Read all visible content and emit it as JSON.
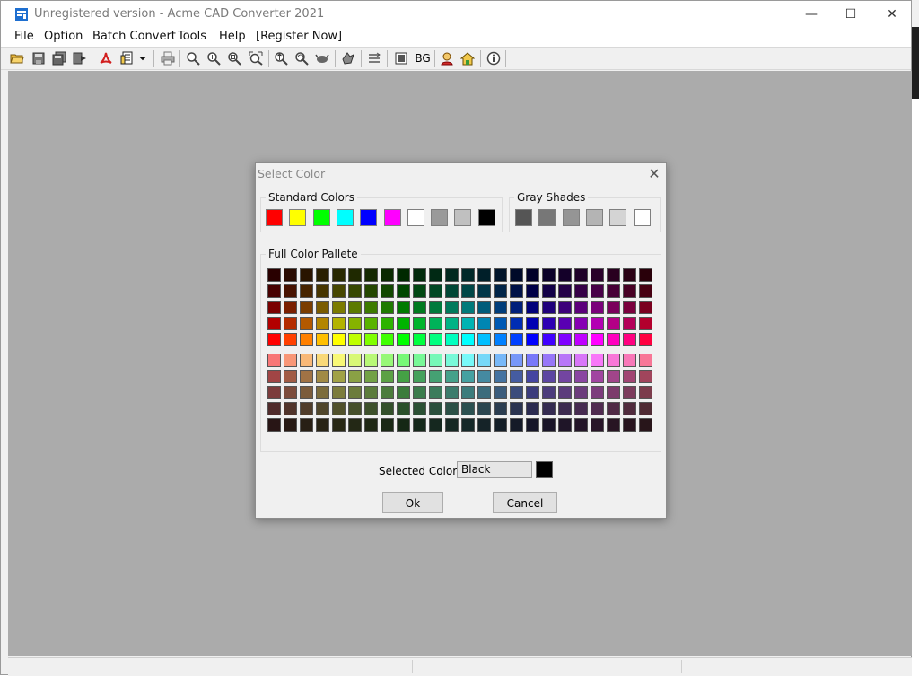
{
  "window": {
    "title": "Unregistered version - Acme CAD Converter 2021",
    "controls": {
      "minimize": "—",
      "maximize": "☐",
      "close": "✕"
    }
  },
  "menu": [
    "File",
    "Option",
    "Batch Convert",
    "Tools",
    "Help",
    "[Register Now]"
  ],
  "toolbar": {
    "bg_label": "BG",
    "icons": [
      "open-folder-icon",
      "save-icon",
      "save-all-icon",
      "export-icon",
      "pdf-convert-icon",
      "batch-icon",
      "dropdown-arrow-icon",
      "print-icon",
      "zoom-out-icon",
      "zoom-in-icon",
      "zoom-window-icon",
      "zoom-extents-icon",
      "zoom-realtime-icon",
      "zoom-previous-icon",
      "pan-icon",
      "layer-icon",
      "rotate-icon",
      "bg-black-icon",
      "bg-label-icon",
      "user-icon",
      "home-icon",
      "info-icon"
    ]
  },
  "dialog": {
    "title": "Select Color",
    "close": "✕",
    "standard_colors_label": "Standard Colors",
    "standard_colors": [
      "#ff0000",
      "#ffff00",
      "#00ff00",
      "#00ffff",
      "#0000ff",
      "#ff00ff",
      "#ffffff",
      "#9a9a9a",
      "#c0c0c0",
      "#000000"
    ],
    "gray_shades_label": "Gray Shades",
    "gray_shades": [
      "#555555",
      "#777777",
      "#959595",
      "#b4b4b4",
      "#d4d4d4",
      "#ffffff"
    ],
    "full_palette_label": "Full Color Pallete",
    "palette_hues": 24,
    "palette_rows": 10,
    "selected_color_label": "Selected Color",
    "selected_color_value": "Black",
    "selected_color_hex": "#000000",
    "ok_label": "Ok",
    "cancel_label": "Cancel"
  }
}
